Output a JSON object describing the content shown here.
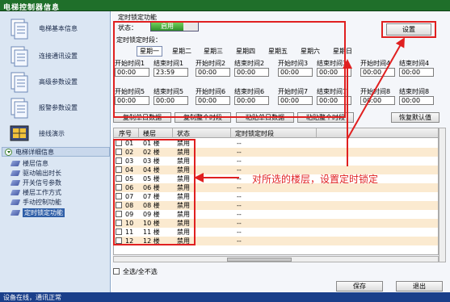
{
  "window": {
    "title": "电梯控制器信息"
  },
  "sidebar": {
    "items": [
      {
        "label": "电梯基本信息",
        "icon": "document-stack-icon"
      },
      {
        "label": "连接通讯设置",
        "icon": "document-stack-icon"
      },
      {
        "label": "高级参数设置",
        "icon": "document-stack-icon"
      },
      {
        "label": "报警参数设置",
        "icon": "document-stack-icon"
      },
      {
        "label": "接线演示",
        "icon": "wiring-icon"
      }
    ],
    "section": {
      "label": "电梯详细信息"
    },
    "subitems": [
      {
        "label": "楼层信息",
        "selected": false
      },
      {
        "label": "驱动输出时长",
        "selected": false
      },
      {
        "label": "开关信号参数",
        "selected": false
      },
      {
        "label": "楼层工作方式",
        "selected": false
      },
      {
        "label": "手动控制功能",
        "selected": false
      },
      {
        "label": "定时锁定功能",
        "selected": true
      }
    ]
  },
  "main": {
    "section_title": "定时锁定功能",
    "status_label": "状态：",
    "status_value": "启用",
    "settings_button": "设置",
    "period_label": "定时锁定时段：",
    "days": [
      "星期一",
      "星期二",
      "星期三",
      "星期四",
      "星期五",
      "星期六",
      "星期日"
    ],
    "selected_day": "星期一",
    "slots_row1": [
      {
        "start_label": "开始时间1",
        "end_label": "结束时间1",
        "start": "00:00",
        "end": "23:59"
      },
      {
        "start_label": "开始时间2",
        "end_label": "结束时间2",
        "start": "00:00",
        "end": "00:00"
      },
      {
        "start_label": "开始时间3",
        "end_label": "结束时间3",
        "start": "00:00",
        "end": "00:00"
      },
      {
        "start_label": "开始时间4",
        "end_label": "结束时间4",
        "start": "00:00",
        "end": "00:00"
      }
    ],
    "slots_row2": [
      {
        "start_label": "开始时间5",
        "end_label": "结束时间5",
        "start": "00:00",
        "end": "00:00"
      },
      {
        "start_label": "开始时间6",
        "end_label": "结束时间6",
        "start": "00:00",
        "end": "00:00"
      },
      {
        "start_label": "开始时间7",
        "end_label": "结束时间7",
        "start": "00:00",
        "end": "00:00"
      },
      {
        "start_label": "开始时间8",
        "end_label": "结束时间8",
        "start": "00:00",
        "end": "00:00"
      }
    ],
    "copy_buttons": [
      "复制单日数据",
      "复制整个时段",
      "粘贴单日数据",
      "粘贴整个时段",
      "恢复默认值"
    ],
    "table": {
      "headers": [
        "序号",
        "楼层",
        "状态",
        "定时锁定时段"
      ],
      "rows": [
        {
          "no": "01",
          "floor": "01 楼",
          "status": "禁用",
          "period": "--"
        },
        {
          "no": "02",
          "floor": "02 楼",
          "status": "禁用",
          "period": "--"
        },
        {
          "no": "03",
          "floor": "03 楼",
          "status": "禁用",
          "period": "--"
        },
        {
          "no": "04",
          "floor": "04 楼",
          "status": "禁用",
          "period": "--"
        },
        {
          "no": "05",
          "floor": "05 楼",
          "status": "禁用",
          "period": "--"
        },
        {
          "no": "06",
          "floor": "06 楼",
          "status": "禁用",
          "period": "--"
        },
        {
          "no": "07",
          "floor": "07 楼",
          "status": "禁用",
          "period": "--"
        },
        {
          "no": "08",
          "floor": "08 楼",
          "status": "禁用",
          "period": "--"
        },
        {
          "no": "09",
          "floor": "09 楼",
          "status": "禁用",
          "period": "--"
        },
        {
          "no": "10",
          "floor": "10 楼",
          "status": "禁用",
          "period": "--"
        },
        {
          "no": "11",
          "floor": "11 楼",
          "status": "禁用",
          "period": "--"
        },
        {
          "no": "12",
          "floor": "12 楼",
          "status": "禁用",
          "period": "--"
        }
      ]
    },
    "select_all": "全选/全不选",
    "save_button": "保存",
    "exit_button": "退出",
    "annotation": "对所选的楼层，设置定时锁定"
  },
  "footer": {
    "status": "设备在线，通讯正常"
  },
  "colors": {
    "accent": "#1f6f2a",
    "highlight": "#e02020",
    "row_alt": "#fbead0",
    "footer": "#1a3f8a"
  }
}
